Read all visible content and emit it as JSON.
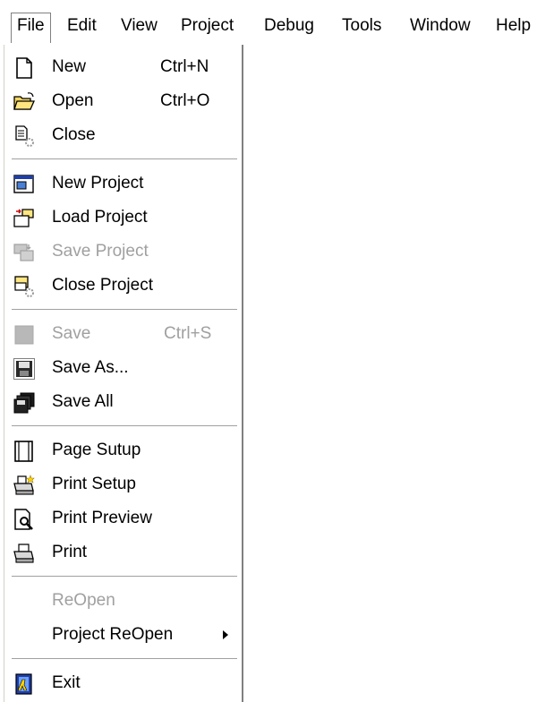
{
  "menubar": {
    "items": [
      "File",
      "Edit",
      "View",
      "Project",
      "Debug",
      "Tools",
      "Window",
      "Help"
    ]
  },
  "file_menu": {
    "new": {
      "label": "New",
      "shortcut": "Ctrl+N",
      "icon": "new-file-icon"
    },
    "open": {
      "label": "Open",
      "shortcut": "Ctrl+O",
      "icon": "open-folder-icon"
    },
    "close": {
      "label": "Close",
      "icon": "close-file-icon"
    },
    "new_project": {
      "label": "New Project",
      "icon": "new-project-icon"
    },
    "load_project": {
      "label": "Load  Project",
      "icon": "load-project-icon"
    },
    "save_project": {
      "label": "Save  Project",
      "icon": "save-project-icon",
      "disabled": true
    },
    "close_project": {
      "label": "Close Project",
      "icon": "close-project-icon"
    },
    "save": {
      "label": "Save",
      "shortcut": "Ctrl+S",
      "icon": "save-icon",
      "disabled": true
    },
    "save_as": {
      "label": "Save As...",
      "icon": "save-as-icon"
    },
    "save_all": {
      "label": "Save All",
      "icon": "save-all-icon"
    },
    "page_setup": {
      "label": "Page Sutup",
      "icon": "page-setup-icon"
    },
    "print_setup": {
      "label": "Print Setup",
      "icon": "print-setup-icon"
    },
    "print_preview": {
      "label": "Print Preview",
      "icon": "print-preview-icon"
    },
    "print": {
      "label": "Print",
      "icon": "printer-icon"
    },
    "reopen": {
      "label": "ReOpen",
      "disabled": true
    },
    "project_reopen": {
      "label": "Project ReOpen",
      "has_submenu": true
    },
    "exit": {
      "label": "Exit",
      "icon": "exit-icon"
    }
  }
}
